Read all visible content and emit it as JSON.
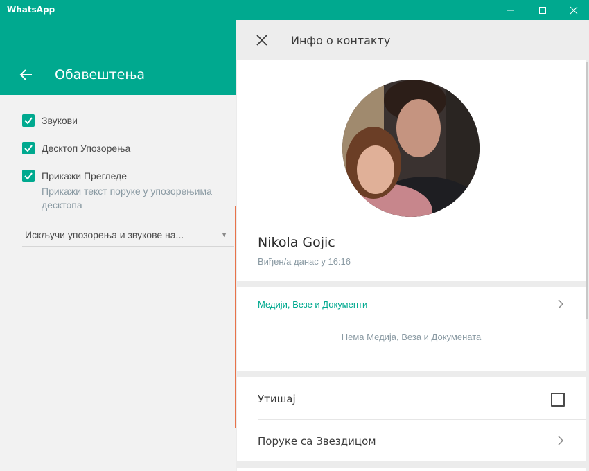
{
  "window": {
    "title": "WhatsApp",
    "controls": [
      "minimize-icon",
      "maximize-icon",
      "close-icon"
    ],
    "accent_color": "#00a98f"
  },
  "left_panel": {
    "title": "Обавештења",
    "options": [
      {
        "label": "Звукови",
        "checked": true
      },
      {
        "label": "Десктоп Упозорења",
        "checked": true
      },
      {
        "label": "Прикажи Прегледе",
        "sublabel": "Прикажи текст поруке у упозорењима десктопа",
        "checked": true
      }
    ],
    "dropdown": {
      "selected": "Искључи упозорења и звукове на..."
    }
  },
  "right_panel": {
    "title": "Инфо о контакту",
    "contact": {
      "name": "Nikola Gojic",
      "last_seen": "Виђен/а данас у 16:16"
    },
    "media": {
      "link_label": "Медији, Везе и Документи",
      "empty_label": "Нема Медија, Веза и Докумената"
    },
    "settings": {
      "mute_label": "Утишај",
      "mute_checked": false,
      "starred_label": "Поруке са Звездицом"
    }
  }
}
